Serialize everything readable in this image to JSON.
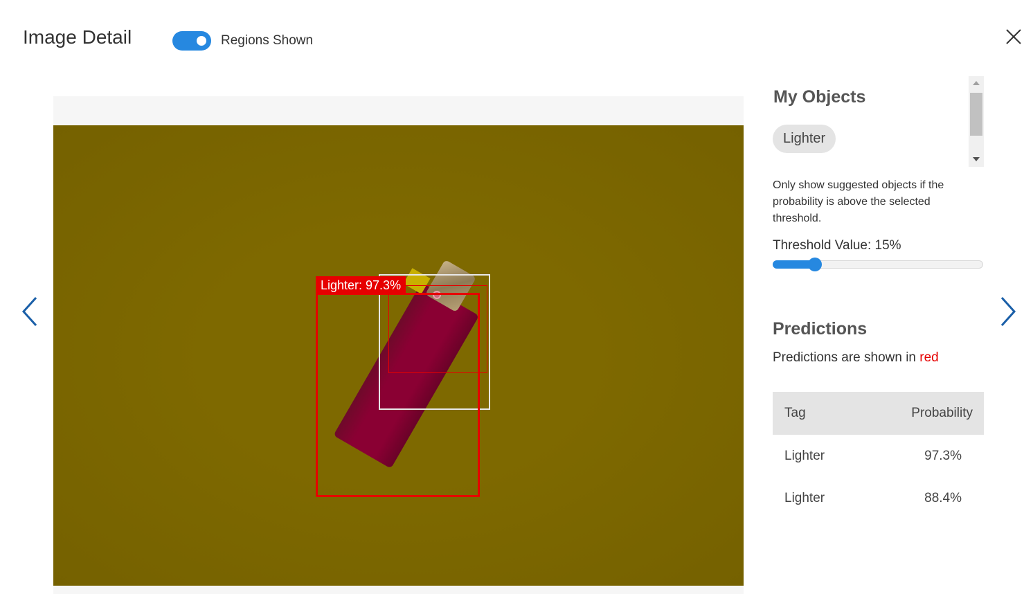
{
  "header": {
    "title": "Image Detail",
    "regions_toggle_label": "Regions Shown",
    "regions_toggle_on": true
  },
  "image": {
    "region_label": "Lighter: 97.3%",
    "colors": {
      "prediction_box": "#e60000",
      "ground_truth_box": "#e8e8e8",
      "overlay": "#7e6900"
    }
  },
  "my_objects": {
    "title": "My Objects",
    "tags": [
      "Lighter"
    ]
  },
  "threshold": {
    "description": "Only show suggested objects if the probability is above the selected threshold.",
    "label": "Threshold Value: 15%",
    "value_percent": 15
  },
  "predictions": {
    "title": "Predictions",
    "note_prefix": "Predictions are shown in ",
    "note_color_word": "red",
    "columns": {
      "tag": "Tag",
      "probability": "Probability"
    },
    "rows": [
      {
        "tag": "Lighter",
        "probability": "97.3%"
      },
      {
        "tag": "Lighter",
        "probability": "88.4%"
      }
    ]
  },
  "icons": {
    "close": "close-icon",
    "prev": "chevron-left-icon",
    "next": "chevron-right-icon"
  },
  "accent_color": "#2688e0"
}
